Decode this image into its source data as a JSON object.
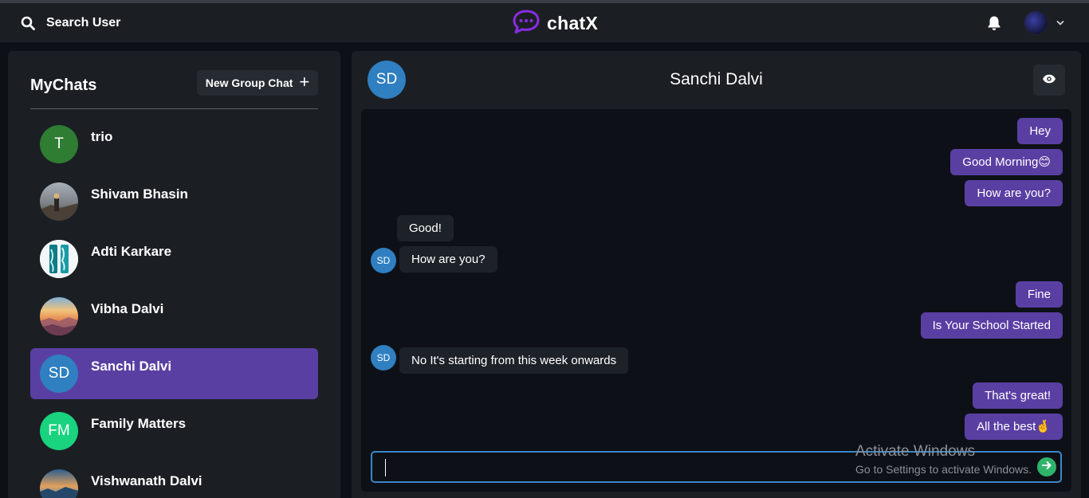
{
  "topbar": {
    "search_label": "Search User",
    "brand": "chatX",
    "icons": [
      "search-icon",
      "chat-bubble-logo-icon",
      "bell-icon",
      "chevron-down-icon"
    ]
  },
  "sidebar": {
    "title": "MyChats",
    "new_group_label": "New Group Chat",
    "new_group_icon": "+",
    "chats": [
      {
        "name": "trio",
        "initials": "T",
        "color": "#2e7d32",
        "active": false
      },
      {
        "name": "Shivam Bhasin",
        "initials": "",
        "color": "#6b6f73",
        "active": false
      },
      {
        "name": "Adti Karkare",
        "initials": "",
        "color": "#e8f3f6",
        "active": false
      },
      {
        "name": "Vibha Dalvi",
        "initials": "",
        "color": "#e39a5a",
        "active": false
      },
      {
        "name": "Sanchi Dalvi",
        "initials": "SD",
        "color": "#2f7fc1",
        "active": true
      },
      {
        "name": "Family Matters",
        "initials": "FM",
        "color": "#19d37e",
        "active": false
      },
      {
        "name": "Vishwanath Dalvi",
        "initials": "",
        "color": "#4a7ba6",
        "active": false
      }
    ]
  },
  "conversation": {
    "title": "Sanchi Dalvi",
    "avatar_initials": "SD",
    "messages": [
      {
        "text": "Hey",
        "sender": "me"
      },
      {
        "text": "Good Morning😊",
        "sender": "me"
      },
      {
        "text": "How are you?",
        "sender": "me"
      },
      {
        "text": "Good!",
        "sender": "them"
      },
      {
        "text": "How are you?",
        "sender": "them"
      },
      {
        "text": "Fine",
        "sender": "me"
      },
      {
        "text": "Is Your School Started",
        "sender": "me"
      },
      {
        "text": "No It's starting from this week onwards",
        "sender": "them"
      },
      {
        "text": "That's great!",
        "sender": "me"
      },
      {
        "text": "All the best🤞",
        "sender": "me"
      }
    ],
    "message_avatar_initials": "SD",
    "input_value": ""
  },
  "watermark": {
    "title": "Activate Windows",
    "subtitle": "Go to Settings to activate Windows."
  },
  "colors": {
    "accent": "#5a3fa3",
    "input_border": "#3a86c8",
    "send": "#2fb36b"
  }
}
